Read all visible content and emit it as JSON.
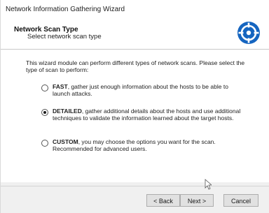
{
  "window": {
    "title": "Network Information Gathering Wizard"
  },
  "header": {
    "title": "Network Scan Type",
    "subtitle": "Select network scan type",
    "logo_icon": "crosshair-target-icon",
    "accent_color": "#1565c0"
  },
  "intro": "This wizard module can perform different types of network scans. Please select the type of scan to perform:",
  "options": [
    {
      "name": "FAST",
      "description": ", gather just enough information about the hosts to be able to launch attacks.",
      "selected": false
    },
    {
      "name": "DETAILED",
      "description": ", gather additional details about the hosts and use additional techniques to validate the information learned about the target hosts.",
      "selected": true
    },
    {
      "name": "CUSTOM",
      "description": ", you may choose the options you want for the scan. Recommended for advanced users.",
      "selected": false
    }
  ],
  "buttons": {
    "back": "< Back",
    "next": "Next >",
    "cancel": "Cancel"
  }
}
